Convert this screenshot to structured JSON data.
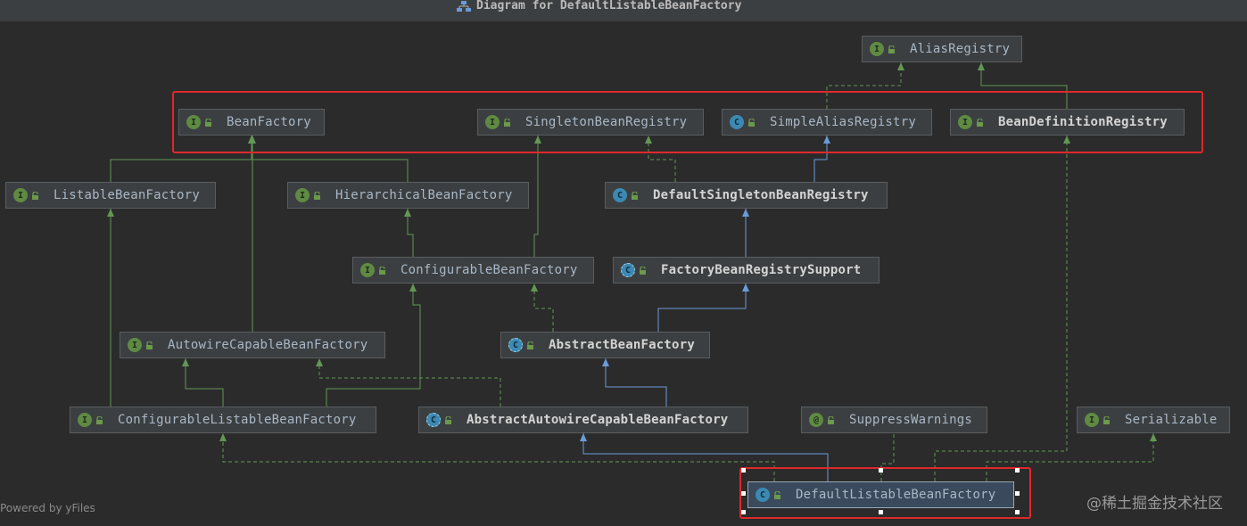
{
  "window": {
    "title": "Diagram for DefaultListableBeanFactory"
  },
  "colors": {
    "extends_line": "#6b9bd9",
    "implements_line": "#629755",
    "highlight": "#e0282b",
    "background": "#2b2b2b",
    "node_fill": "#3c3f41"
  },
  "nodes": [
    {
      "id": "AliasRegistry",
      "label": "AliasRegistry",
      "kind": "interface",
      "badge": "I",
      "bold": false
    },
    {
      "id": "BeanFactory",
      "label": "BeanFactory",
      "kind": "interface",
      "badge": "I",
      "bold": false
    },
    {
      "id": "SingletonBeanRegistry",
      "label": "SingletonBeanRegistry",
      "kind": "interface",
      "badge": "I",
      "bold": false
    },
    {
      "id": "SimpleAliasRegistry",
      "label": "SimpleAliasRegistry",
      "kind": "class",
      "badge": "C",
      "bold": false
    },
    {
      "id": "BeanDefinitionRegistry",
      "label": "BeanDefinitionRegistry",
      "kind": "interface",
      "badge": "I",
      "bold": true
    },
    {
      "id": "ListableBeanFactory",
      "label": "ListableBeanFactory",
      "kind": "interface",
      "badge": "I",
      "bold": false
    },
    {
      "id": "HierarchicalBeanFactory",
      "label": "HierarchicalBeanFactory",
      "kind": "interface",
      "badge": "I",
      "bold": false
    },
    {
      "id": "DefaultSingletonBeanRegistry",
      "label": "DefaultSingletonBeanRegistry",
      "kind": "class",
      "badge": "C",
      "bold": true
    },
    {
      "id": "ConfigurableBeanFactory",
      "label": "ConfigurableBeanFactory",
      "kind": "interface",
      "badge": "I",
      "bold": false
    },
    {
      "id": "FactoryBeanRegistrySupport",
      "label": "FactoryBeanRegistrySupport",
      "kind": "abstract",
      "badge": "C",
      "bold": true
    },
    {
      "id": "AutowireCapableBeanFactory",
      "label": "AutowireCapableBeanFactory",
      "kind": "interface",
      "badge": "I",
      "bold": false
    },
    {
      "id": "AbstractBeanFactory",
      "label": "AbstractBeanFactory",
      "kind": "abstract",
      "badge": "C",
      "bold": true
    },
    {
      "id": "ConfigurableListableBeanFactory",
      "label": "ConfigurableListableBeanFactory",
      "kind": "interface",
      "badge": "I",
      "bold": false
    },
    {
      "id": "AbstractAutowireCapableBeanFactory",
      "label": "AbstractAutowireCapableBeanFactory",
      "kind": "abstract",
      "badge": "C",
      "bold": true
    },
    {
      "id": "SuppressWarnings",
      "label": "SuppressWarnings",
      "kind": "annotation",
      "badge": "@",
      "bold": false
    },
    {
      "id": "Serializable",
      "label": "Serializable",
      "kind": "interface",
      "badge": "I",
      "bold": false
    },
    {
      "id": "DefaultListableBeanFactory",
      "label": "DefaultListableBeanFactory",
      "kind": "class",
      "badge": "C",
      "bold": false,
      "selected": true
    }
  ],
  "edges": [
    {
      "from": "SimpleAliasRegistry",
      "to": "AliasRegistry",
      "type": "implements"
    },
    {
      "from": "BeanDefinitionRegistry",
      "to": "AliasRegistry",
      "type": "extends-interface"
    },
    {
      "from": "ListableBeanFactory",
      "to": "BeanFactory",
      "type": "extends-interface"
    },
    {
      "from": "HierarchicalBeanFactory",
      "to": "BeanFactory",
      "type": "extends-interface"
    },
    {
      "from": "DefaultSingletonBeanRegistry",
      "to": "SingletonBeanRegistry",
      "type": "implements"
    },
    {
      "from": "DefaultSingletonBeanRegistry",
      "to": "SimpleAliasRegistry",
      "type": "extends"
    },
    {
      "from": "ConfigurableBeanFactory",
      "to": "HierarchicalBeanFactory",
      "type": "extends-interface"
    },
    {
      "from": "ConfigurableBeanFactory",
      "to": "SingletonBeanRegistry",
      "type": "extends-interface"
    },
    {
      "from": "FactoryBeanRegistrySupport",
      "to": "DefaultSingletonBeanRegistry",
      "type": "extends"
    },
    {
      "from": "AutowireCapableBeanFactory",
      "to": "BeanFactory",
      "type": "extends-interface"
    },
    {
      "from": "AbstractBeanFactory",
      "to": "ConfigurableBeanFactory",
      "type": "implements"
    },
    {
      "from": "AbstractBeanFactory",
      "to": "FactoryBeanRegistrySupport",
      "type": "extends"
    },
    {
      "from": "ConfigurableListableBeanFactory",
      "to": "ListableBeanFactory",
      "type": "extends-interface"
    },
    {
      "from": "ConfigurableListableBeanFactory",
      "to": "AutowireCapableBeanFactory",
      "type": "extends-interface"
    },
    {
      "from": "ConfigurableListableBeanFactory",
      "to": "ConfigurableBeanFactory",
      "type": "extends-interface"
    },
    {
      "from": "AbstractAutowireCapableBeanFactory",
      "to": "AbstractBeanFactory",
      "type": "extends"
    },
    {
      "from": "AbstractAutowireCapableBeanFactory",
      "to": "AutowireCapableBeanFactory",
      "type": "implements"
    },
    {
      "from": "DefaultListableBeanFactory",
      "to": "AbstractAutowireCapableBeanFactory",
      "type": "extends"
    },
    {
      "from": "DefaultListableBeanFactory",
      "to": "ConfigurableListableBeanFactory",
      "type": "implements"
    },
    {
      "from": "DefaultListableBeanFactory",
      "to": "BeanDefinitionRegistry",
      "type": "implements"
    },
    {
      "from": "DefaultListableBeanFactory",
      "to": "Serializable",
      "type": "implements"
    },
    {
      "from": "DefaultListableBeanFactory",
      "to": "SuppressWarnings",
      "type": "annotated"
    }
  ],
  "footer": {
    "powered_by": "Powered by yFiles",
    "watermark": "@稀土掘金技术社区"
  }
}
